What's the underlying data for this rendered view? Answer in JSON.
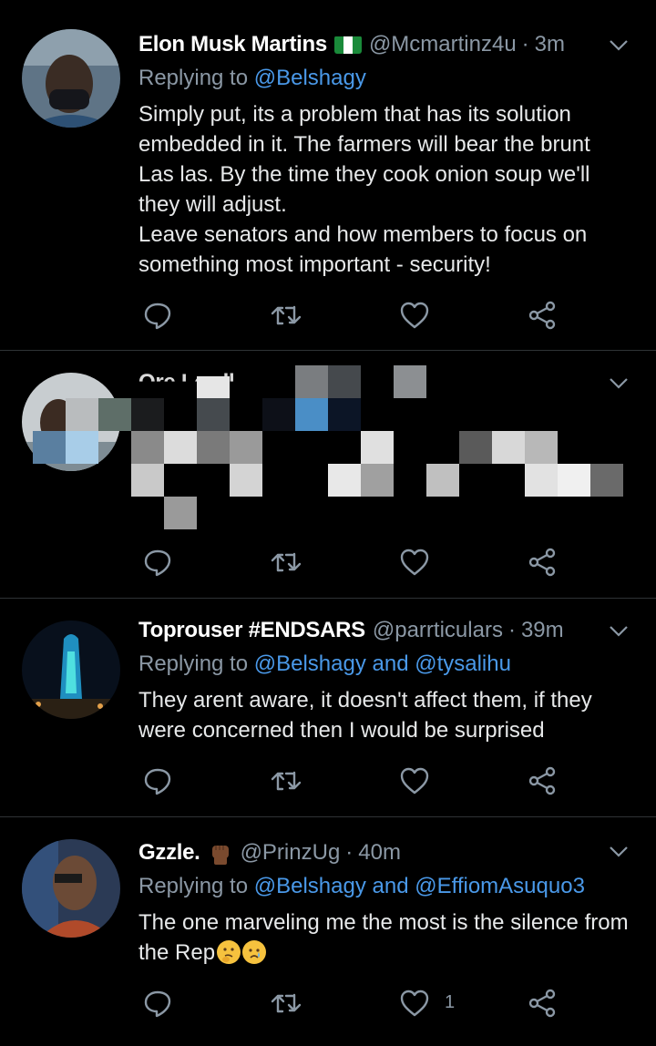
{
  "tweets": [
    {
      "name": "Elon Musk Martins",
      "handle": "@Mcmartinz4u",
      "separator": "·",
      "time": "3m",
      "replying_prefix": "Replying to",
      "replying_to": "@Belshagy",
      "body_lines": [
        "Simply put, its a problem that has its solution embedded in it. The farmers will bear the brunt Las las. By the time they cook onion soup we'll they will adjust.",
        "Leave senators and how members to focus on something most important - security!"
      ],
      "like_count": ""
    },
    {
      "name": "Ore Lordl",
      "handle": "",
      "separator": "",
      "time": "",
      "like_count": ""
    },
    {
      "name": "Toprouser #ENDSARS",
      "handle": "@parrticulars",
      "separator": "·",
      "time": "39m",
      "replying_prefix": "Replying to",
      "replying_to": "@Belshagy and @tysalihu",
      "body_lines": [
        "They arent aware, it doesn't affect them, if they were concerned then I would be surprised"
      ],
      "like_count": ""
    },
    {
      "name": "Gzzle.",
      "handle": "@PrinzUg",
      "separator": "·",
      "time": "40m",
      "replying_prefix": "Replying to",
      "replying_to": "@Belshagy and @EffiomAsuquo3",
      "body_lines": [
        "The one marveling me the most is the silence from the Rep"
      ],
      "like_count": "1"
    }
  ],
  "icons": [
    "reply-icon",
    "retweet-icon",
    "like-icon",
    "share-icon",
    "chevron-down-icon"
  ],
  "colors": {
    "background": "#000000",
    "divider": "#2f3336",
    "secondary_text": "#8b98a5",
    "link": "#4a99e9"
  }
}
